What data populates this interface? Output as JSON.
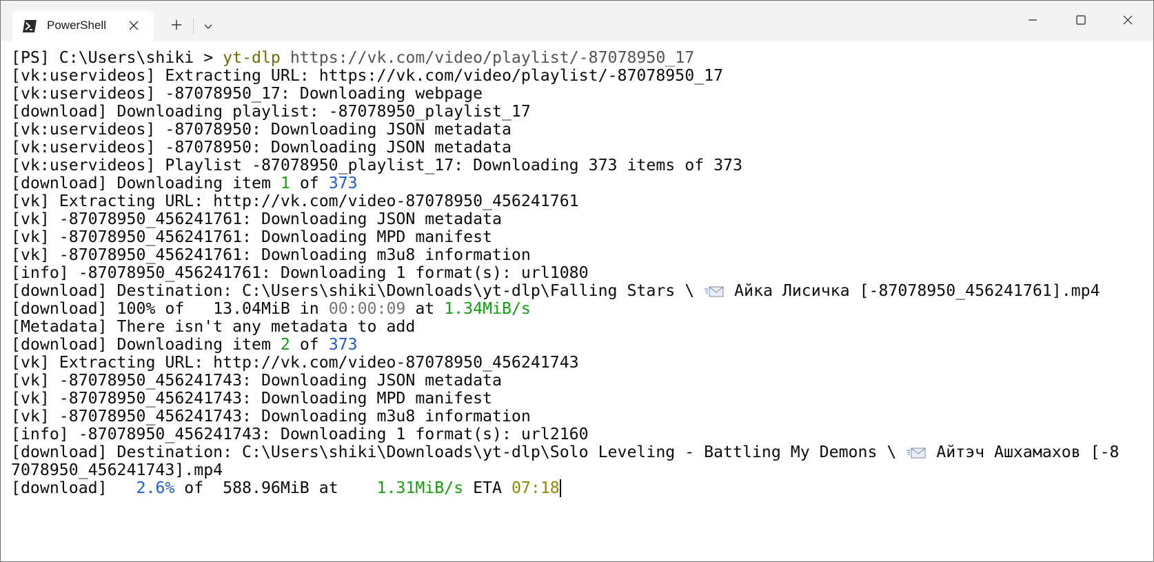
{
  "window": {
    "tab": {
      "title": "PowerShell",
      "icon": "powershell-icon"
    },
    "caption_buttons": [
      "minimize-icon",
      "maximize-icon",
      "close-icon"
    ],
    "colors": {
      "titlebar": "#f3f3f3",
      "text": "#0c0c0c",
      "green": "#13a10e",
      "blue": "#0037da",
      "olive": "#8a8a00",
      "dim": "#767676"
    }
  },
  "terminal": {
    "prompt": {
      "path": "[PS] C:\\Users\\shiki > ",
      "command": "yt-dlp",
      "argument": " https://vk.com/video/playlist/-87078950_17"
    },
    "lines": [
      "[vk:uservideos] Extracting URL: https://vk.com/video/playlist/-87078950_17",
      "[vk:uservideos] -87078950_17: Downloading webpage",
      "[download] Downloading playlist: -87078950_playlist_17",
      "[vk:uservideos] -87078950: Downloading JSON metadata",
      "[vk:uservideos] -87078950: Downloading JSON metadata",
      "[vk:uservideos] Playlist -87078950_playlist_17: Downloading 373 items of 373"
    ],
    "item1": {
      "prefix": "[download] Downloading item ",
      "index": "1",
      "of": " of ",
      "total": "373"
    },
    "item1_lines": [
      "[vk] Extracting URL: http://vk.com/video-87078950_456241761",
      "[vk] -87078950_456241761: Downloading JSON metadata",
      "[vk] -87078950_456241761: Downloading MPD manifest",
      "[vk] -87078950_456241761: Downloading m3u8 information",
      "[info] -87078950_456241761: Downloading 1 format(s): url1080"
    ],
    "dest1": {
      "before": "[download] Destination: C:\\Users\\shiki\\Downloads\\yt-dlp\\Falling Stars \\ ",
      "after": " Айка Лисичка [-87078950_456241761].mp4"
    },
    "done1": {
      "prefix": "[download] 100% of   13.04MiB in ",
      "elapsed": "00:00:09",
      "at": " at ",
      "speed": "1.34MiB/s"
    },
    "metadata_line": "[Metadata] There isn't any metadata to add",
    "item2": {
      "prefix": "[download] Downloading item ",
      "index": "2",
      "of": " of ",
      "total": "373"
    },
    "item2_lines": [
      "[vk] Extracting URL: http://vk.com/video-87078950_456241743",
      "[vk] -87078950_456241743: Downloading JSON metadata",
      "[vk] -87078950_456241743: Downloading MPD manifest",
      "[vk] -87078950_456241743: Downloading m3u8 information",
      "[info] -87078950_456241743: Downloading 1 format(s): url2160"
    ],
    "dest2": {
      "before": "[download] Destination: C:\\Users\\shiki\\Downloads\\yt-dlp\\Solo Leveling - Battling My Demons \\ ",
      "after": " Айтэч Ашхамахов [-8",
      "wrap": "7078950_456241743].mp4"
    },
    "progress": {
      "prefix": "[download]   ",
      "percent": "2.6%",
      "mid": " of  588.96MiB at    ",
      "speed": "1.31MiB/s",
      "eta_label": " ETA ",
      "eta": "07:18"
    }
  }
}
